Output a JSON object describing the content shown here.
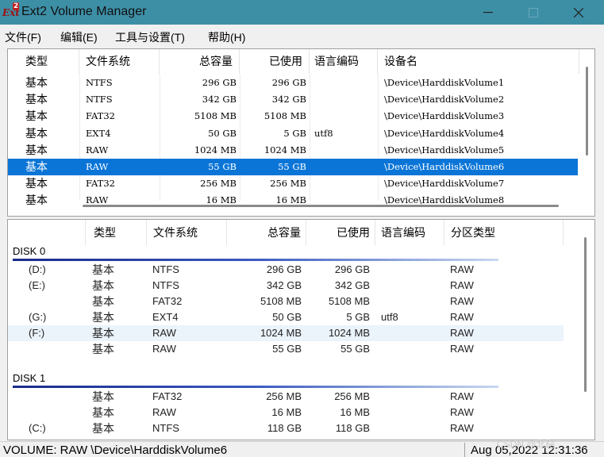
{
  "window": {
    "title": "Ext2 Volume Manager",
    "icon": "ext2-app-icon",
    "icon_text_a": "Ext",
    "icon_text_b": "2"
  },
  "menu": [
    "文件(F)",
    "编辑(E)",
    "工具与设置(T)",
    "帮助(H)"
  ],
  "volumes": {
    "columns": [
      "类型",
      "文件系统",
      "总容量",
      "已使用",
      "语言编码",
      "设备名"
    ],
    "rows": [
      {
        "type": "基本",
        "fs": "NTFS",
        "total": "296 GB",
        "used": "296 GB",
        "codepage": "",
        "device": "\\Device\\HarddiskVolume1"
      },
      {
        "type": "基本",
        "fs": "NTFS",
        "total": "342 GB",
        "used": "342 GB",
        "codepage": "",
        "device": "\\Device\\HarddiskVolume2"
      },
      {
        "type": "基本",
        "fs": "FAT32",
        "total": "5108 MB",
        "used": "5108 MB",
        "codepage": "",
        "device": "\\Device\\HarddiskVolume3"
      },
      {
        "type": "基本",
        "fs": "EXT4",
        "total": "50 GB",
        "used": "5 GB",
        "codepage": "utf8",
        "device": "\\Device\\HarddiskVolume4"
      },
      {
        "type": "基本",
        "fs": "RAW",
        "total": "1024 MB",
        "used": "1024 MB",
        "codepage": "",
        "device": "\\Device\\HarddiskVolume5"
      },
      {
        "type": "基本",
        "fs": "RAW",
        "total": "55 GB",
        "used": "55 GB",
        "codepage": "",
        "device": "\\Device\\HarddiskVolume6",
        "selected": true
      },
      {
        "type": "基本",
        "fs": "FAT32",
        "total": "256 MB",
        "used": "256 MB",
        "codepage": "",
        "device": "\\Device\\HarddiskVolume7"
      },
      {
        "type": "基本",
        "fs": "RAW",
        "total": "16 MB",
        "used": "16 MB",
        "codepage": "",
        "device": "\\Device\\HarddiskVolume8"
      }
    ],
    "selected_color": "#0a75d7"
  },
  "disks": {
    "columns": [
      "类型",
      "文件系统",
      "总容量",
      "已使用",
      "语言编码",
      "分区类型"
    ],
    "groups": [
      {
        "label": "DISK 0",
        "rows": [
          {
            "drive": "(D:)",
            "type": "基本",
            "fs": "NTFS",
            "total": "296 GB",
            "used": "296 GB",
            "codepage": "",
            "ptype": "RAW"
          },
          {
            "drive": "(E:)",
            "type": "基本",
            "fs": "NTFS",
            "total": "342 GB",
            "used": "342 GB",
            "codepage": "",
            "ptype": "RAW"
          },
          {
            "drive": "",
            "type": "基本",
            "fs": "FAT32",
            "total": "5108 MB",
            "used": "5108 MB",
            "codepage": "",
            "ptype": "RAW"
          },
          {
            "drive": "(G:)",
            "type": "基本",
            "fs": "EXT4",
            "total": "50 GB",
            "used": "5 GB",
            "codepage": "utf8",
            "ptype": "RAW"
          },
          {
            "drive": "(F:)",
            "type": "基本",
            "fs": "RAW",
            "total": "1024 MB",
            "used": "1024 MB",
            "codepage": "",
            "ptype": "RAW",
            "highlight": true
          },
          {
            "drive": "",
            "type": "基本",
            "fs": "RAW",
            "total": "55 GB",
            "used": "55 GB",
            "codepage": "",
            "ptype": "RAW"
          }
        ]
      },
      {
        "label": "DISK 1",
        "rows": [
          {
            "drive": "",
            "type": "基本",
            "fs": "FAT32",
            "total": "256 MB",
            "used": "256 MB",
            "codepage": "",
            "ptype": "RAW"
          },
          {
            "drive": "",
            "type": "基本",
            "fs": "RAW",
            "total": "16 MB",
            "used": "16 MB",
            "codepage": "",
            "ptype": "RAW"
          },
          {
            "drive": "(C:)",
            "type": "基本",
            "fs": "NTFS",
            "total": "118 GB",
            "used": "118 GB",
            "codepage": "",
            "ptype": "RAW"
          }
        ]
      }
    ]
  },
  "status": {
    "left": "VOLUME:  RAW \\Device\\HarddiskVolume6",
    "right": "Aug 05,2022 12:31:36"
  },
  "watermark": "CSDN @北砧"
}
